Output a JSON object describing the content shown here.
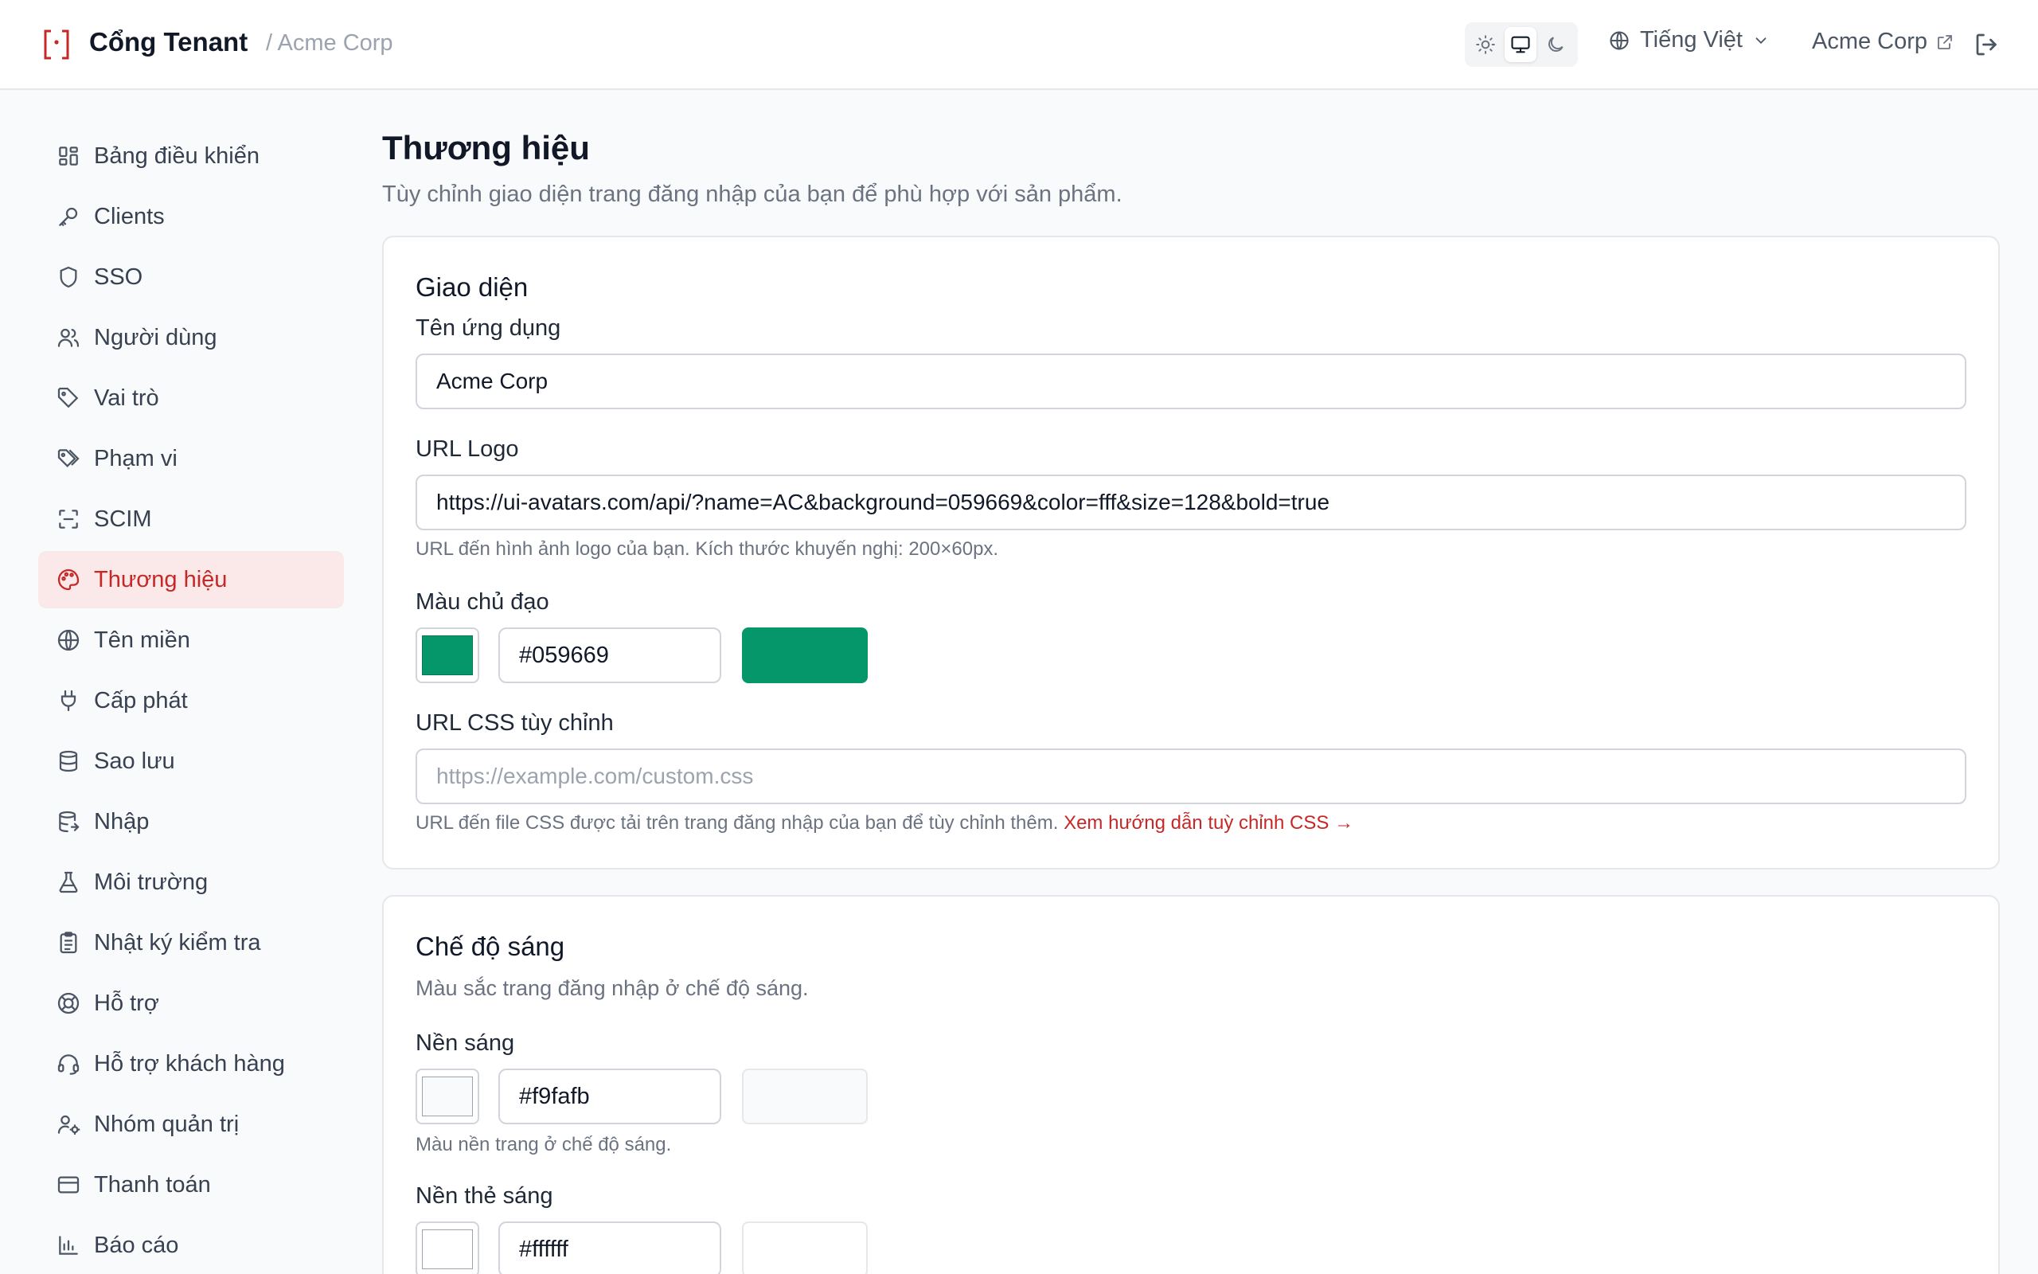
{
  "header": {
    "title": "Cổng Tenant",
    "subtitle": "/ Acme Corp",
    "language": "Tiếng Việt",
    "tenant_link": "Acme Corp"
  },
  "sidebar": {
    "items": [
      {
        "label": "Bảng điều khiển",
        "icon": "dashboard-icon"
      },
      {
        "label": "Clients",
        "icon": "key-icon"
      },
      {
        "label": "SSO",
        "icon": "shield-icon"
      },
      {
        "label": "Người dùng",
        "icon": "users-icon"
      },
      {
        "label": "Vai trò",
        "icon": "tag-icon"
      },
      {
        "label": "Phạm vi",
        "icon": "tags-icon"
      },
      {
        "label": "SCIM",
        "icon": "scan-icon"
      },
      {
        "label": "Thương hiệu",
        "icon": "palette-icon",
        "active": true
      },
      {
        "label": "Tên miền",
        "icon": "globe-icon"
      },
      {
        "label": "Cấp phát",
        "icon": "plug-icon"
      },
      {
        "label": "Sao lưu",
        "icon": "database-icon"
      },
      {
        "label": "Nhập",
        "icon": "database-import-icon"
      },
      {
        "label": "Môi trường",
        "icon": "flask-icon"
      },
      {
        "label": "Nhật ký kiểm tra",
        "icon": "clipboard-icon"
      },
      {
        "label": "Hỗ trợ",
        "icon": "lifebuoy-icon"
      },
      {
        "label": "Hỗ trợ khách hàng",
        "icon": "headset-icon"
      },
      {
        "label": "Nhóm quản trị",
        "icon": "user-cog-icon"
      },
      {
        "label": "Thanh toán",
        "icon": "credit-card-icon"
      },
      {
        "label": "Báo cáo",
        "icon": "bar-chart-icon"
      }
    ]
  },
  "main": {
    "title": "Thương hiệu",
    "subtitle": "Tùy chỉnh giao diện trang đăng nhập của bạn để phù hợp với sản phẩm."
  },
  "appearance": {
    "title": "Giao diện",
    "app_name_label": "Tên ứng dụng",
    "app_name_value": "Acme Corp",
    "logo_label": "URL Logo",
    "logo_value": "https://ui-avatars.com/api/?name=AC&background=059669&color=fff&size=128&bold=true",
    "logo_help": "URL đến hình ảnh logo của bạn. Kích thước khuyến nghị: 200×60px.",
    "primary_label": "Màu chủ đạo",
    "primary_value": "#059669",
    "css_label": "URL CSS tùy chỉnh",
    "css_placeholder": "https://example.com/custom.css",
    "css_help": "URL đến file CSS được tải trên trang đăng nhập của bạn để tùy chỉnh thêm.",
    "css_link": "Xem hướng dẫn tuỳ chỉnh CSS →"
  },
  "light_mode": {
    "title": "Chế độ sáng",
    "description": "Màu sắc trang đăng nhập ở chế độ sáng.",
    "bg_label": "Nền sáng",
    "bg_value": "#f9fafb",
    "bg_help": "Màu nền trang ở chế độ sáng.",
    "card_label": "Nền thẻ sáng",
    "card_value": "#ffffff"
  },
  "colors": {
    "accent": "#c62828",
    "primary": "#059669",
    "light_bg": "#f9fafb",
    "light_card": "#ffffff"
  }
}
